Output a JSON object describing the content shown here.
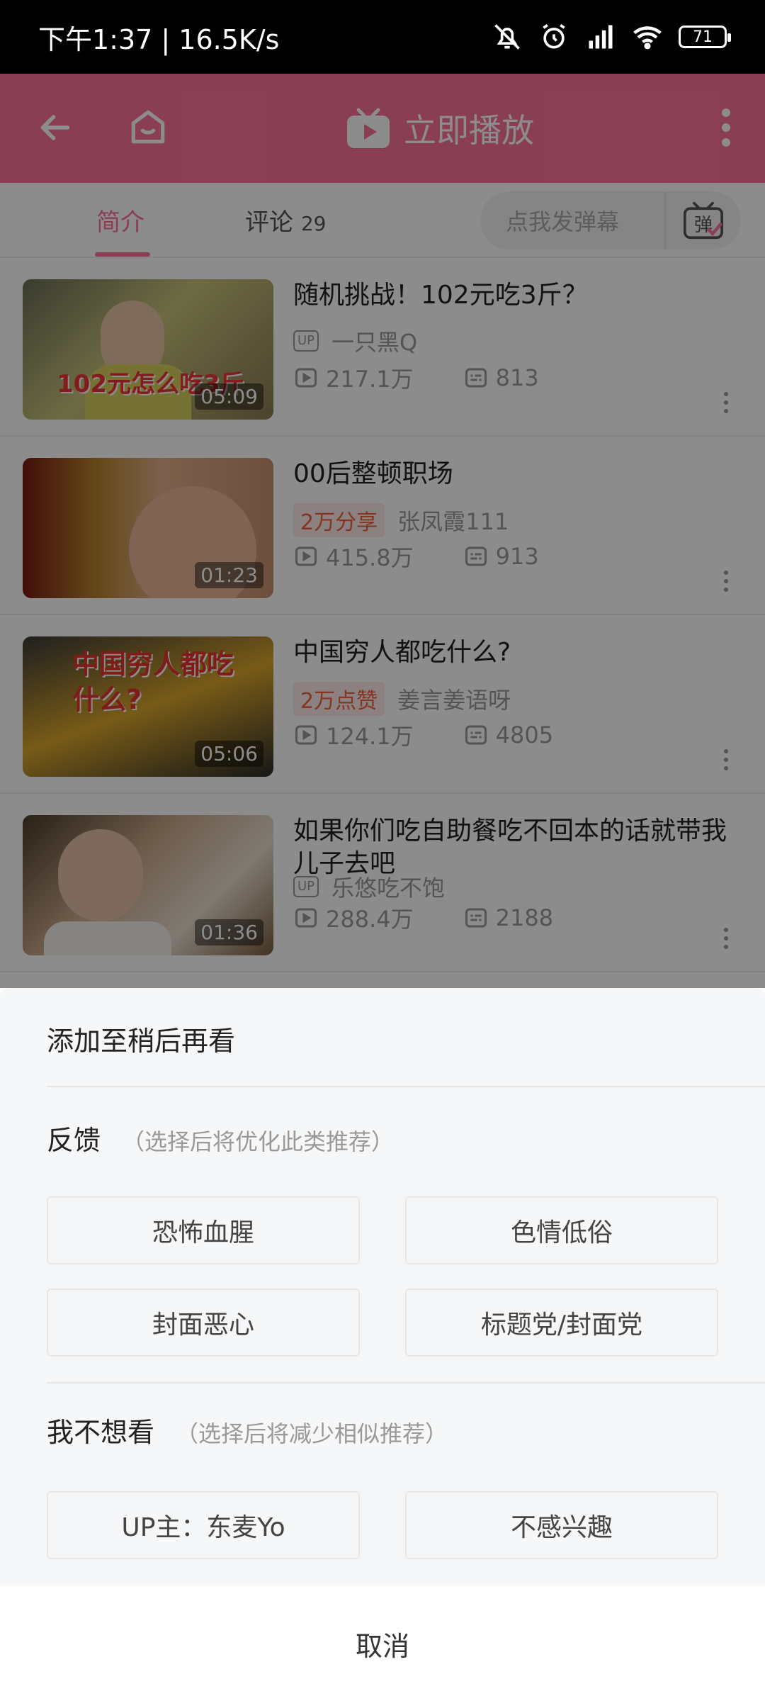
{
  "status_bar": {
    "time": "下午1:37 | 16.5K/s",
    "battery": "71"
  },
  "topbar": {
    "play_label": "立即播放"
  },
  "tabs": [
    {
      "label": "简介"
    },
    {
      "label": "评论",
      "count": "29"
    }
  ],
  "danmu": {
    "placeholder": "点我发弹幕",
    "button_icon_text": "弹"
  },
  "videos": [
    {
      "title": "随机挑战！102元吃3斤？",
      "thumb_text": "102元怎么吃3斤",
      "duration": "05:09",
      "badge": "UP",
      "uploader": "一只黑Q",
      "views": "217.1万",
      "danmaku": "813"
    },
    {
      "title": "00后整顿职场",
      "duration": "01:23",
      "tag": "2万分享",
      "uploader": "张凤霞111",
      "views": "415.8万",
      "danmaku": "913"
    },
    {
      "title": "中国穷人都吃什么?",
      "thumb_text": "中国穷人都吃什么?",
      "duration": "05:06",
      "tag": "2万点赞",
      "uploader": "姜言姜语呀",
      "views": "124.1万",
      "danmaku": "4805"
    },
    {
      "title": "如果你们吃自助餐吃不回本的话就带我儿子去吧",
      "duration": "01:36",
      "badge": "UP",
      "uploader": "乐悠吃不饱",
      "views": "288.4万",
      "danmaku": "2188"
    }
  ],
  "sheet": {
    "watch_later": "添加至稍后再看",
    "feedback": {
      "title": "反馈",
      "subtitle": "（选择后将优化此类推荐）",
      "options": [
        "恐怖血腥",
        "色情低俗",
        "封面恶心",
        "标题党/封面党"
      ]
    },
    "dislike": {
      "title": "我不想看",
      "subtitle": "（选择后将减少相似推荐）",
      "options": [
        "UP主：东麦Yo",
        "不感兴趣"
      ]
    },
    "cancel": "取消"
  },
  "colors": {
    "accent": "#fb7299",
    "status_bar": "#000000",
    "sheet_bg": "#f6f7f9"
  }
}
